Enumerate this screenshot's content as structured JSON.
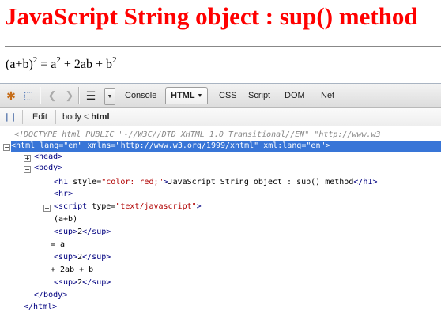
{
  "page": {
    "heading": "JavaScript String object : sup() method",
    "equation": {
      "part1": "(a+b)",
      "sup1": "2",
      "part2": " = a",
      "sup2": "2",
      "part3": " + 2ab + b",
      "sup3": "2"
    }
  },
  "firebug": {
    "toolbar": {
      "tabs": [
        "Console",
        "HTML",
        "CSS",
        "Script",
        "DOM",
        "Net"
      ],
      "active_tab": "HTML",
      "icons": [
        "inspect-icon",
        "cursor-icon",
        "back-icon",
        "forward-icon",
        "menu-icon",
        "dropdown-arrow-icon"
      ]
    },
    "breadcrumb_bar": {
      "edit_label": "Edit",
      "path": [
        "body",
        "html"
      ],
      "arrow": "<"
    },
    "tree": {
      "doctype": "<!DOCTYPE html PUBLIC \"-//W3C//DTD XHTML 1.0 Transitional//EN\" \"http://www.w3",
      "html_open": {
        "tag": "html",
        "attrs": [
          {
            "name": "lang",
            "value": "\"en\""
          },
          {
            "name": "xmlns",
            "value": "\"http://www.w3.org/1999/xhtml\""
          },
          {
            "name": "xml:lang",
            "value": "\"en\""
          }
        ]
      },
      "head": "head",
      "body": "body",
      "h1": {
        "attr_name": "style",
        "attr_value": "\"color: red;\"",
        "text": "JavaScript String object : sup() method"
      },
      "hr": "hr",
      "script": {
        "attr_name": "type",
        "attr_value": "\"text/javascript\""
      },
      "text_ab": "(a+b)",
      "sup_text": "2",
      "text_eq": "= a",
      "text_plus": "+ 2ab + b",
      "body_close": "body",
      "html_close": "html"
    }
  },
  "colors": {
    "heading": "#ff0000",
    "selection": "#3875d7",
    "tag": "#000080",
    "attr_value": "#b00000"
  }
}
